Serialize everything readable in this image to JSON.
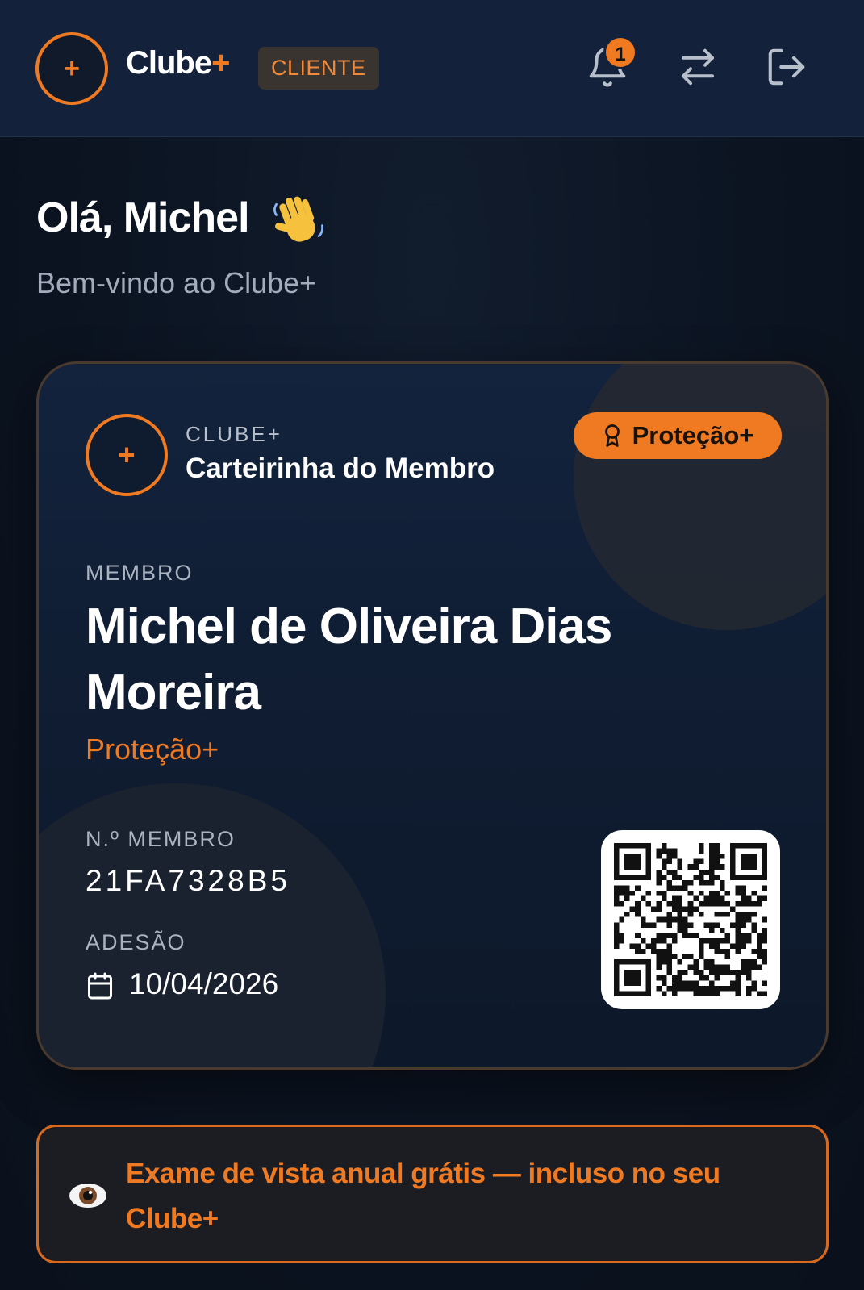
{
  "header": {
    "brand_name": "Clube",
    "brand_plus": "+",
    "role_badge": "CLIENTE",
    "notification_count": "1",
    "icons": [
      "plus-icon",
      "bell-icon",
      "swap-icon",
      "logout-icon"
    ]
  },
  "greeting": {
    "title": "Olá, Michel",
    "emoji": "waving-hand",
    "subtitle": "Bem-vindo ao Clube+"
  },
  "card": {
    "brand": "CLUBE+",
    "title": "Carteirinha do Membro",
    "plan_badge": "Proteção+",
    "member_label": "MEMBRO",
    "member_name": "Michel de Oliveira Dias Moreira",
    "member_plan": "Proteção+",
    "id_label": "N.º MEMBRO",
    "member_id": "21FA7328B5",
    "join_label": "ADESÃO",
    "join_date": "10/04/2026"
  },
  "banner": {
    "text": "Exame de vista anual grátis — incluso no seu Clube+",
    "icon": "eye-icon"
  },
  "colors": {
    "accent": "#f07a22",
    "header_bg": "#13213a",
    "page_bg": "#0b1320",
    "card_bg": "#13233d"
  }
}
